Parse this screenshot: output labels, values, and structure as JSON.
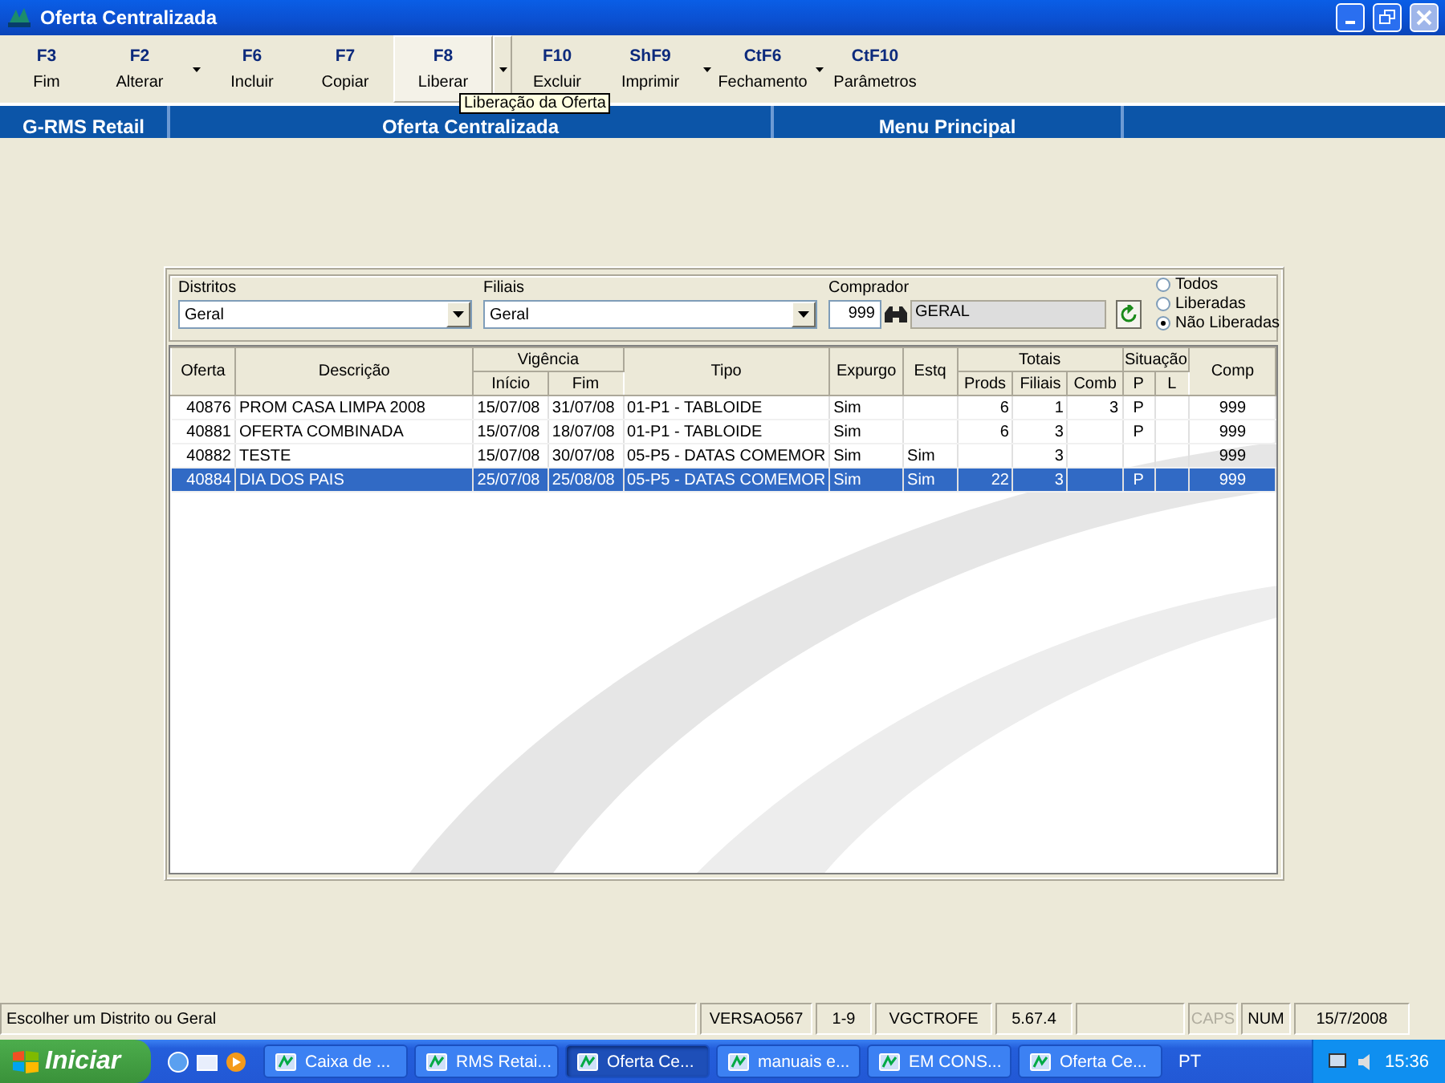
{
  "window": {
    "title": "Oferta Centralizada"
  },
  "toolbar": [
    {
      "key": "F3",
      "label": "Fim",
      "has_menu": false,
      "highlighted": false
    },
    {
      "key": "F2",
      "label": "Alterar",
      "has_menu": true,
      "highlighted": false
    },
    {
      "key": "F6",
      "label": "Incluir",
      "has_menu": false,
      "highlighted": false
    },
    {
      "key": "F7",
      "label": "Copiar",
      "has_menu": false,
      "highlighted": false
    },
    {
      "key": "F8",
      "label": "Liberar",
      "has_menu": true,
      "highlighted": true
    },
    {
      "key": "F10",
      "label": "Excluir",
      "has_menu": false,
      "highlighted": false
    },
    {
      "key": "ShF9",
      "label": "Imprimir",
      "has_menu": true,
      "highlighted": false
    },
    {
      "key": "CtF6",
      "label": "Fechamento",
      "has_menu": true,
      "highlighted": false
    },
    {
      "key": "CtF10",
      "label": "Parâmetros",
      "has_menu": false,
      "highlighted": false
    }
  ],
  "tooltip": "Liberação da Oferta",
  "nav_bar": [
    "G-RMS Retail",
    "Oferta Centralizada",
    "Menu Principal"
  ],
  "filters": {
    "districts": {
      "label": "Distritos",
      "value": "Geral"
    },
    "branches": {
      "label": "Filiais",
      "value": "Geral"
    },
    "buyer": {
      "label": "Comprador",
      "code": "999",
      "name": "GERAL"
    },
    "status_options": [
      {
        "label": "Todos",
        "selected": false
      },
      {
        "label": "Liberadas",
        "selected": false
      },
      {
        "label": "Não Liberadas",
        "selected": true
      }
    ]
  },
  "table": {
    "columns": [
      {
        "label": "Oferta"
      },
      {
        "label": "Descrição"
      },
      {
        "label": "Vigência",
        "colspan": 2,
        "children": [
          "Início",
          "Fim"
        ]
      },
      {
        "label": "Tipo"
      },
      {
        "label": "Expurgo"
      },
      {
        "label": "Estq"
      },
      {
        "label": "Totais",
        "colspan": 3,
        "children": [
          "Prods",
          "Filiais",
          "Comb"
        ]
      },
      {
        "label": "Situação",
        "colspan": 2,
        "children": [
          "P",
          "L"
        ]
      },
      {
        "label": "Comp"
      }
    ],
    "rows": [
      {
        "selected": false,
        "cells": [
          "40876",
          "PROM CASA LIMPA 2008",
          "15/07/08",
          "31/07/08",
          "01-P1 - TABLOIDE",
          "Sim",
          "",
          "6",
          "1",
          "3",
          "P",
          "",
          "999"
        ]
      },
      {
        "selected": false,
        "cells": [
          "40881",
          "OFERTA COMBINADA",
          "15/07/08",
          "18/07/08",
          "01-P1 - TABLOIDE",
          "Sim",
          "",
          "6",
          "3",
          "",
          "P",
          "",
          "999"
        ]
      },
      {
        "selected": false,
        "cells": [
          "40882",
          "TESTE",
          "15/07/08",
          "30/07/08",
          "05-P5 - DATAS COMEMOR",
          "Sim",
          "Sim",
          "",
          "3",
          "",
          "",
          "",
          "999"
        ]
      },
      {
        "selected": true,
        "cells": [
          "40884",
          "DIA DOS PAIS",
          "25/07/08",
          "25/08/08",
          "05-P5 - DATAS COMEMOR",
          "Sim",
          "Sim",
          "22",
          "3",
          "",
          "P",
          "",
          "999"
        ]
      }
    ]
  },
  "status_bar": [
    {
      "text": "Escolher um Distrito ou Geral",
      "disabled": false
    },
    {
      "text": "VERSAO567",
      "disabled": false
    },
    {
      "text": "1-9",
      "disabled": false
    },
    {
      "text": "VGCTROFE",
      "disabled": false
    },
    {
      "text": "5.67.4",
      "disabled": false
    },
    {
      "text": "CAPS",
      "disabled": true
    },
    {
      "text": "NUM",
      "disabled": false
    },
    {
      "text": "15/7/2008",
      "disabled": false
    }
  ],
  "taskbar": {
    "start": "Iniciar",
    "tasks": [
      {
        "label": "Caixa de ...",
        "selected": false
      },
      {
        "label": "RMS Retai...",
        "selected": false
      },
      {
        "label": "Oferta Ce...",
        "selected": true
      },
      {
        "label": "manuais e...",
        "selected": false
      },
      {
        "label": "EM CONS...",
        "selected": false
      },
      {
        "label": "Oferta Ce...",
        "selected": false
      }
    ],
    "language": "PT",
    "clock": "15:36"
  }
}
